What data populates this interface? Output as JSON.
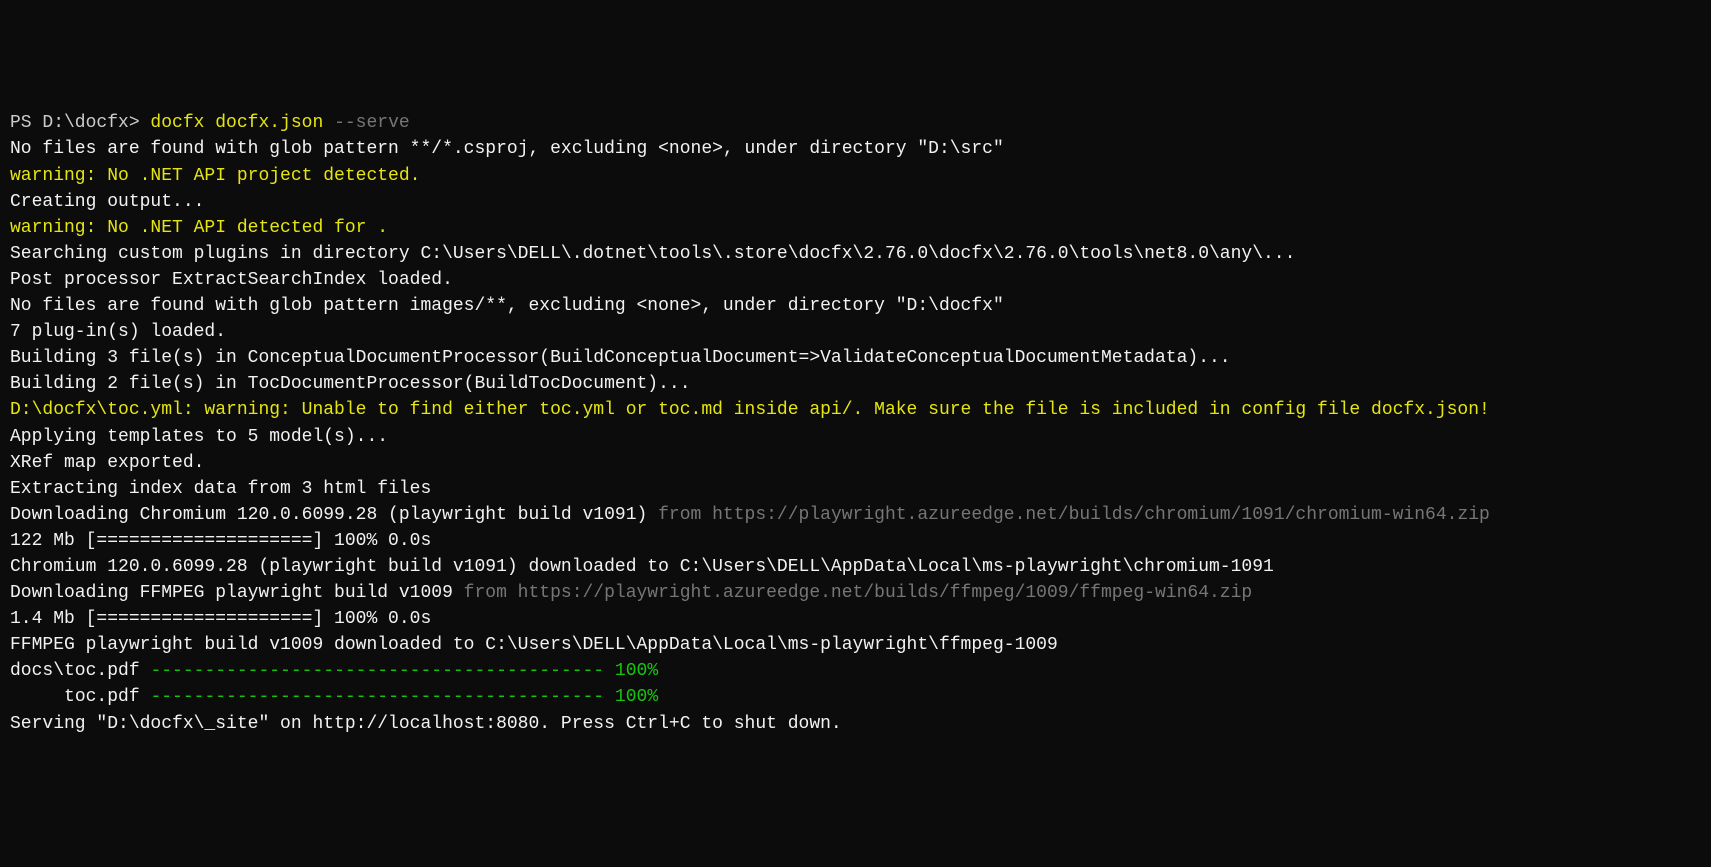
{
  "prompt": {
    "prefix": "PS ",
    "path": "D:\\docfx>",
    "command1": " docfx docfx.json",
    "command2": " --serve"
  },
  "lines": {
    "l1": "No files are found with glob pattern **/*.csproj, excluding <none>, under directory \"D:\\src\"",
    "l2": "warning: No .NET API project detected.",
    "l3": "Creating output...",
    "l4": "warning: No .NET API detected for .",
    "l5": "Searching custom plugins in directory C:\\Users\\DELL\\.dotnet\\tools\\.store\\docfx\\2.76.0\\docfx\\2.76.0\\tools\\net8.0\\any\\...",
    "l6": "Post processor ExtractSearchIndex loaded.",
    "l7": "No files are found with glob pattern images/**, excluding <none>, under directory \"D:\\docfx\"",
    "l8": "7 plug-in(s) loaded.",
    "l9": "Building 3 file(s) in ConceptualDocumentProcessor(BuildConceptualDocument=>ValidateConceptualDocumentMetadata)...",
    "l10": "Building 2 file(s) in TocDocumentProcessor(BuildTocDocument)...",
    "l11": "D:\\docfx\\toc.yml: warning: Unable to find either toc.yml or toc.md inside api/. Make sure the file is included in config file docfx.json!",
    "l12": "Applying templates to 5 model(s)...",
    "l13": "XRef map exported.",
    "l14": "Extracting index data from 3 html files",
    "l15a": "Downloading Chromium 120.0.6099.28 (playwright build v1091)",
    "l15b": " from https://playwright.azureedge.net/builds/chromium/1091/chromium-win64.zip",
    "l16": "122 Mb [====================] 100% 0.0s",
    "l17": "Chromium 120.0.6099.28 (playwright build v1091) downloaded to C:\\Users\\DELL\\AppData\\Local\\ms-playwright\\chromium-1091",
    "l18a": "Downloading FFMPEG playwright build v1009",
    "l18b": " from https://playwright.azureedge.net/builds/ffmpeg/1009/ffmpeg-win64.zip",
    "l19": "1.4 Mb [====================] 100% 0.0s",
    "l20": "FFMPEG playwright build v1009 downloaded to C:\\Users\\DELL\\AppData\\Local\\ms-playwright\\ffmpeg-1009",
    "l21": "",
    "l22a": "docs\\toc.pdf ",
    "l22b": "------------------------------------------ 100%",
    "l23a": "     toc.pdf ",
    "l23b": "------------------------------------------ 100%",
    "l24": "",
    "l25": "Serving \"D:\\docfx\\_site\" on http://localhost:8080. Press Ctrl+C to shut down."
  }
}
